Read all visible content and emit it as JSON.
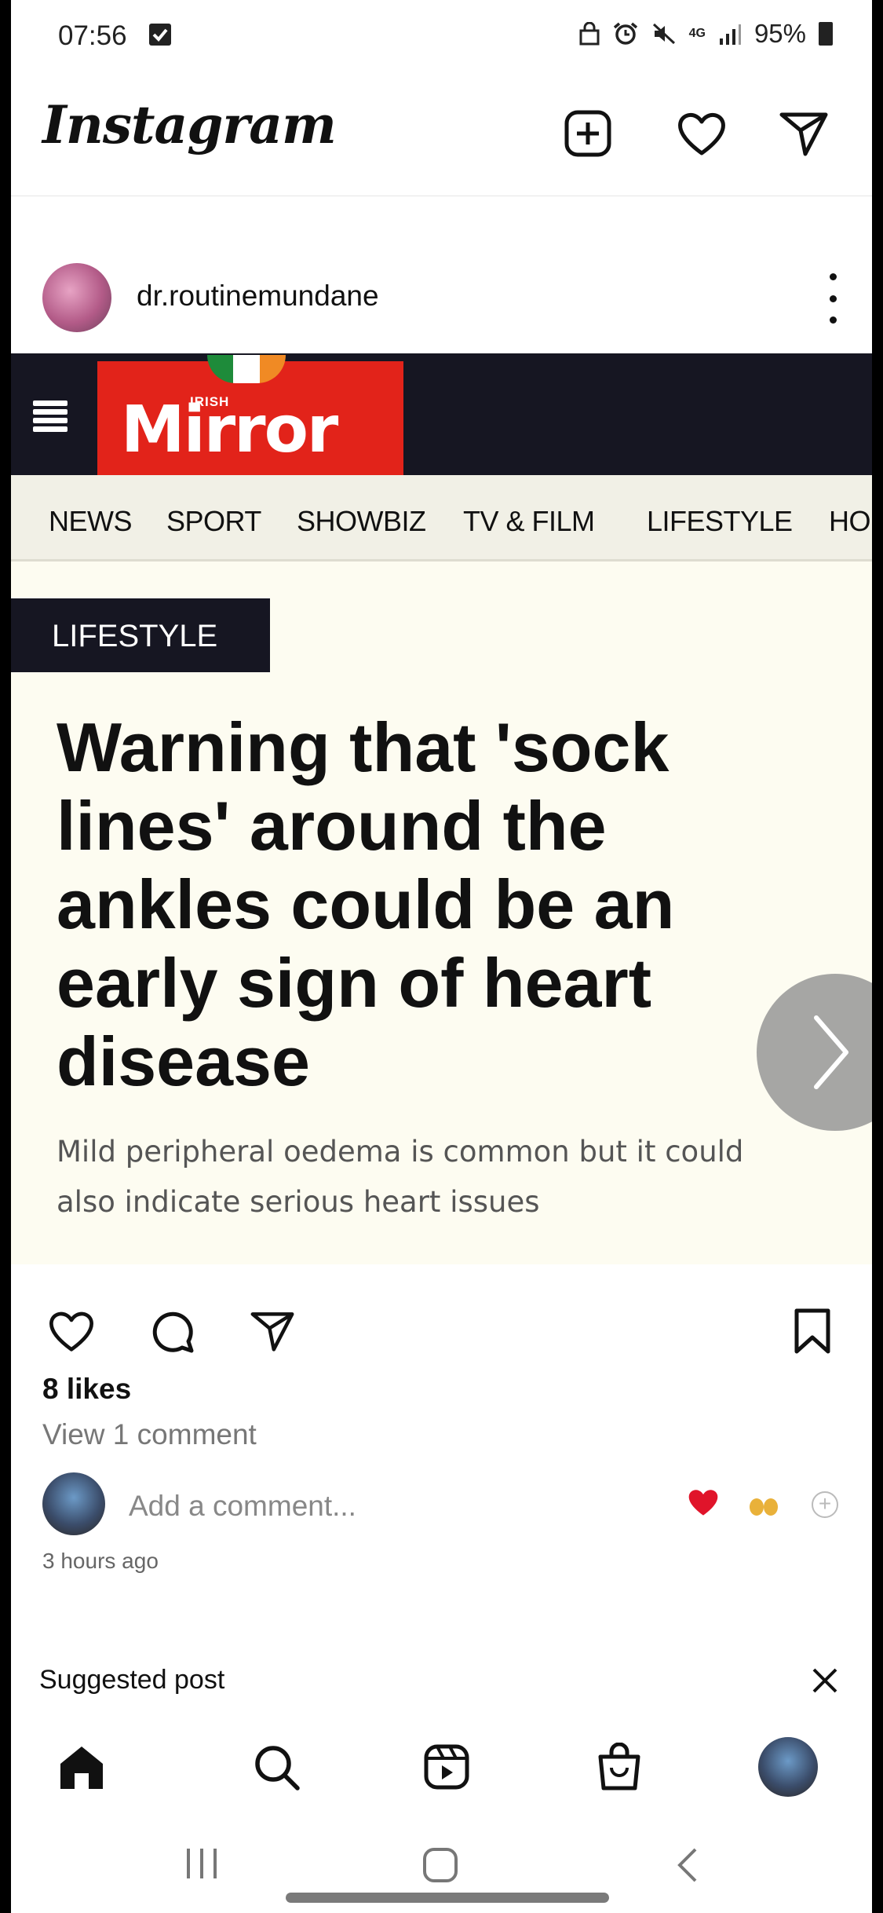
{
  "status_bar": {
    "time": "07:56",
    "network": "4G",
    "battery": "95%"
  },
  "header": {
    "app_name": "Instagram",
    "icons": [
      "new-post-icon",
      "heart-icon",
      "direct-message-icon"
    ]
  },
  "post": {
    "username": "dr.routinemundane",
    "image": {
      "site_logo_small": "IRISH",
      "site_logo": "Mirror",
      "nav": [
        "NEWS",
        "SPORT",
        "SHOWBIZ",
        "TV & FILM",
        "LIFESTYLE",
        "HO"
      ],
      "section": "LIFESTYLE",
      "headline": "Warning that 'sock lines' around the ankles could be an early sign of heart disease",
      "subhead_line1": "Mild peripheral oedema is common but it could",
      "subhead_line2": "also indicate serious heart issues"
    },
    "likes": "8 likes",
    "view_comments": "View 1 comment",
    "comment_placeholder": "Add a comment...",
    "timestamp": "3 hours ago"
  },
  "suggested": {
    "label": "Suggested post"
  },
  "bottom_nav": [
    "home-icon",
    "search-icon",
    "reels-icon",
    "shop-icon",
    "profile-avatar"
  ],
  "colors": {
    "mirror_red": "#e2231a",
    "mirror_dark": "#161622",
    "article_bg": "#fdfcf1",
    "heart_red": "#e0142a"
  }
}
